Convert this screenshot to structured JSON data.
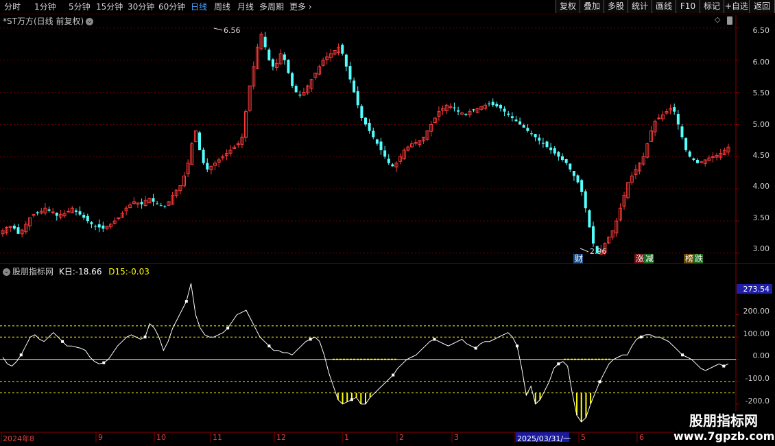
{
  "top_periods": [
    "分时",
    "1分钟",
    "5分钟",
    "15分钟",
    "30分钟",
    "60分钟",
    "日线",
    "周线",
    "月线",
    "多周期",
    "更多"
  ],
  "active_period": "日线",
  "top_buttons": [
    "复权",
    "叠加",
    "多股",
    "统计",
    "画线",
    "F10",
    "标记",
    "+自选",
    "返回"
  ],
  "main_title": "*ST万方(日线 前复权)",
  "price_axis": [
    "6.50",
    "6.00",
    "5.50",
    "5.00",
    "4.50",
    "4.00",
    "3.50",
    "3.00"
  ],
  "high_label": "6.56",
  "low_label": "2.96",
  "tags": {
    "cai": "财",
    "zhang": "涨",
    "jian": "减",
    "bang": "榜",
    "die": "跌"
  },
  "indicator": {
    "name": "股朋指标网",
    "k_label": "K日:",
    "k_value": "-18.66",
    "d_label": "D15:",
    "d_value": "-0.03"
  },
  "ind_axis": [
    "200.00",
    "100.00",
    "0.00",
    "-100.0",
    "-200.0"
  ],
  "ind_current": "273.54",
  "date_axis": [
    "2024年8",
    "9",
    "10",
    "11",
    "12",
    "1",
    "2",
    "3",
    "2025/03/31/一",
    "5",
    "6"
  ],
  "watermark": {
    "line1": "股朋指标网",
    "line2": "www.7gpzb.com"
  },
  "colors": {
    "up": "#ff3b3b",
    "down": "#54ffff",
    "grid": "#6a0000",
    "active": "#4aa3ff",
    "k_line": "#ffffff",
    "d_line": "#ffff00"
  },
  "chart_data": [
    {
      "type": "candlestick",
      "title": "*ST万方(日线 前复权)",
      "ylim": [
        2.85,
        6.7
      ],
      "closes": [
        3.35,
        3.4,
        3.42,
        3.38,
        3.3,
        3.36,
        3.45,
        3.55,
        3.6,
        3.62,
        3.65,
        3.7,
        3.66,
        3.64,
        3.58,
        3.6,
        3.62,
        3.65,
        3.7,
        3.64,
        3.6,
        3.55,
        3.5,
        3.45,
        3.42,
        3.4,
        3.38,
        3.42,
        3.45,
        3.5,
        3.55,
        3.62,
        3.7,
        3.75,
        3.8,
        3.78,
        3.76,
        3.82,
        3.85,
        3.8,
        3.76,
        3.74,
        3.72,
        3.8,
        3.9,
        3.98,
        4.05,
        4.2,
        4.4,
        4.7,
        4.9,
        4.6,
        4.4,
        4.3,
        4.35,
        4.4,
        4.45,
        4.5,
        4.55,
        4.6,
        4.65,
        4.7,
        4.8,
        5.2,
        5.6,
        5.9,
        6.2,
        6.4,
        6.2,
        6.0,
        5.9,
        5.95,
        6.1,
        6.0,
        5.8,
        5.6,
        5.5,
        5.45,
        5.5,
        5.6,
        5.7,
        5.8,
        5.9,
        6.0,
        6.05,
        6.1,
        6.15,
        6.2,
        6.1,
        5.9,
        5.7,
        5.5,
        5.3,
        5.1,
        5.0,
        4.9,
        4.8,
        4.7,
        4.6,
        4.5,
        4.4,
        4.35,
        4.4,
        4.5,
        4.6,
        4.65,
        4.7,
        4.72,
        4.75,
        4.8,
        4.9,
        5.0,
        5.1,
        5.2,
        5.25,
        5.3,
        5.28,
        5.25,
        5.2,
        5.18,
        5.15,
        5.2,
        5.22,
        5.25,
        5.28,
        5.3,
        5.32,
        5.3,
        5.28,
        5.25,
        5.2,
        5.15,
        5.1,
        5.05,
        5.0,
        4.95,
        4.9,
        4.85,
        4.8,
        4.75,
        4.7,
        4.65,
        4.6,
        4.55,
        4.5,
        4.45,
        4.4,
        4.3,
        4.2,
        4.1,
        3.95,
        3.7,
        3.4,
        3.15,
        3.0,
        3.05,
        3.15,
        3.25,
        3.35,
        3.5,
        3.7,
        3.9,
        4.1,
        4.2,
        4.3,
        4.4,
        4.5,
        4.7,
        4.9,
        5.05,
        5.1,
        5.15,
        5.2,
        5.25,
        5.2,
        5.0,
        4.8,
        4.6,
        4.5,
        4.45,
        4.4,
        4.42,
        4.45,
        4.48,
        4.5,
        4.52,
        4.55,
        4.6,
        4.65
      ],
      "high": 6.56,
      "low": 2.96
    },
    {
      "type": "line",
      "title": "股朋指标网",
      "ylim": [
        -320,
        380
      ],
      "series": [
        {
          "name": "K日",
          "values": [
            10,
            -20,
            -30,
            -10,
            20,
            60,
            100,
            110,
            90,
            80,
            100,
            120,
            100,
            80,
            60,
            60,
            55,
            50,
            40,
            10,
            -10,
            -20,
            -15,
            0,
            30,
            60,
            80,
            100,
            110,
            100,
            90,
            100,
            160,
            140,
            100,
            40,
            80,
            140,
            180,
            220,
            260,
            340,
            200,
            140,
            110,
            100,
            100,
            110,
            120,
            140,
            170,
            200,
            210,
            220,
            180,
            140,
            100,
            80,
            60,
            40,
            40,
            30,
            30,
            20,
            40,
            60,
            80,
            90,
            100,
            80,
            20,
            -60,
            -120,
            -180,
            -200,
            -190,
            -180,
            -170,
            -200,
            -200,
            -170,
            -150,
            -130,
            -110,
            -90,
            -70,
            -40,
            -20,
            0,
            10,
            20,
            40,
            60,
            80,
            90,
            80,
            70,
            60,
            70,
            80,
            90,
            70,
            60,
            50,
            70,
            80,
            80,
            90,
            100,
            110,
            120,
            100,
            60,
            -40,
            -160,
            -120,
            -200,
            -180,
            -140,
            -100,
            -40,
            -20,
            -10,
            -30,
            -150,
            -250,
            -280,
            -260,
            -200,
            -150,
            -100,
            -60,
            -20,
            0,
            10,
            20,
            20,
            60,
            90,
            100,
            110,
            110,
            100,
            100,
            90,
            80,
            60,
            40,
            20,
            10,
            0,
            -20,
            -40,
            -50,
            -40,
            -30,
            -20,
            -30,
            -20
          ]
        },
        {
          "name": "D15",
          "values": [
            0
          ]
        }
      ],
      "yticks": [
        200,
        100,
        0,
        -100,
        -200
      ],
      "reference_lines": [
        150,
        100,
        -100,
        -150
      ]
    }
  ]
}
